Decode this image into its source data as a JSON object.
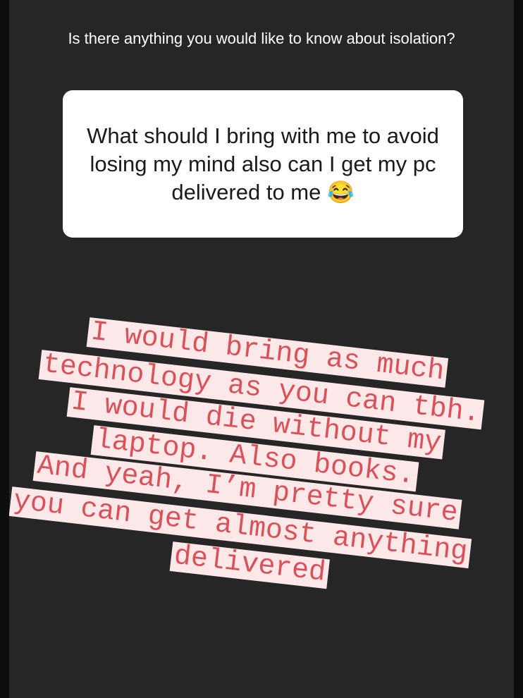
{
  "story": {
    "question": "Is there anything you would like to know about isolation?",
    "answer": "What should I bring with me to avoid losing my mind also can I get my pc delivered to me 😂"
  },
  "reply": {
    "lines": [
      "I would bring as much",
      "technology as you can tbh.",
      "I would die without my",
      "laptop. Also books.",
      "And yeah, I’m pretty sure",
      "you can get almost anything",
      "delivered"
    ]
  },
  "colors": {
    "story_background": "#262626",
    "text_highlight": "#fde8e9",
    "text_color": "#d9525a"
  }
}
